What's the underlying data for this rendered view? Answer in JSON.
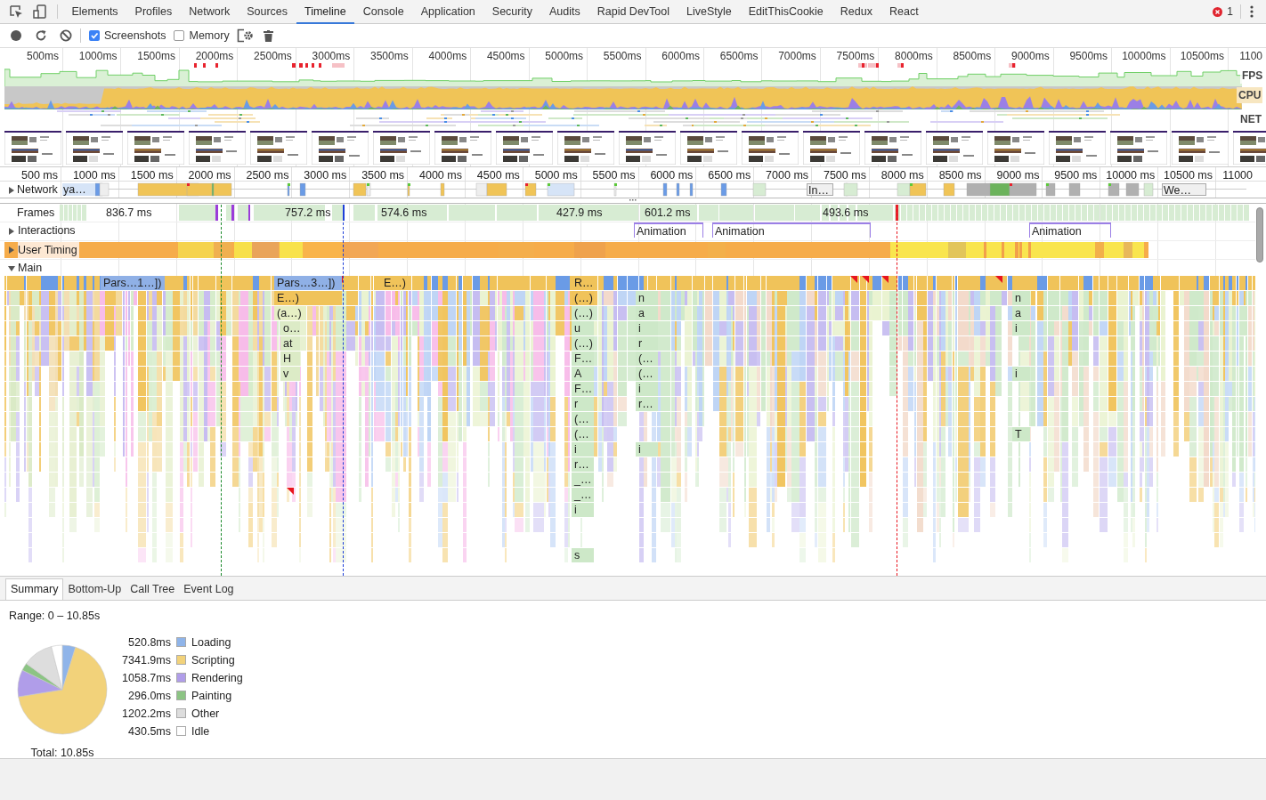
{
  "top_bar": {
    "tabs": [
      {
        "label": "Elements",
        "selected": false
      },
      {
        "label": "Profiles",
        "selected": false
      },
      {
        "label": "Network",
        "selected": false
      },
      {
        "label": "Sources",
        "selected": false
      },
      {
        "label": "Timeline",
        "selected": true
      },
      {
        "label": "Console",
        "selected": false
      },
      {
        "label": "Application",
        "selected": false
      },
      {
        "label": "Security",
        "selected": false
      },
      {
        "label": "Audits",
        "selected": false
      },
      {
        "label": "Rapid DevTool",
        "selected": false
      },
      {
        "label": "LiveStyle",
        "selected": false
      },
      {
        "label": "EditThisCookie",
        "selected": false
      },
      {
        "label": "Redux",
        "selected": false
      },
      {
        "label": "React",
        "selected": false
      }
    ],
    "error_count": "1"
  },
  "toolbar": {
    "options": [
      {
        "label": "Screenshots",
        "checked": true
      },
      {
        "label": "Memory",
        "checked": false
      }
    ]
  },
  "overview": {
    "ticks": [
      "500ms",
      "1000ms",
      "1500ms",
      "2000ms",
      "2500ms",
      "3000ms",
      "3500ms",
      "4000ms",
      "4500ms",
      "5000ms",
      "5500ms",
      "6000ms",
      "6500ms",
      "7000ms",
      "7500ms",
      "8000ms",
      "8500ms",
      "9000ms",
      "9500ms",
      "10000ms",
      "10500ms",
      "1100"
    ],
    "lanes": [
      "FPS",
      "CPU",
      "NET"
    ]
  },
  "ruler": {
    "ticks": [
      "500 ms",
      "1000 ms",
      "1500 ms",
      "2000 ms",
      "2500 ms",
      "3000 ms",
      "3500 ms",
      "4000 ms",
      "4500 ms",
      "5000 ms",
      "5500 ms",
      "6000 ms",
      "6500 ms",
      "7000 ms",
      "7500 ms",
      "8000 ms",
      "8500 ms",
      "9000 ms",
      "9500 ms",
      "10000 ms",
      "10500 ms",
      "11000"
    ]
  },
  "network": {
    "label": "Network",
    "expanded": false,
    "requests": [
      {
        "text": "ya…"
      },
      {
        "text": "In…"
      },
      {
        "text": "We…"
      }
    ]
  },
  "frames": {
    "label": "Frames",
    "durations": [
      "836.7 ms",
      "757.2 ms",
      "574.6 ms",
      "427.9 ms",
      "601.2 ms",
      "493.6 ms"
    ]
  },
  "interactions": {
    "label": "Interactions",
    "expanded": false,
    "entries": [
      "Animation",
      "Animation",
      "Animation"
    ]
  },
  "user_timing": {
    "label": "User Timing",
    "expanded": false
  },
  "main": {
    "label": "Main",
    "expanded": true,
    "columns": [
      {
        "entries": [
          "Pars…1…])"
        ]
      },
      {
        "entries": [
          "Pars…3…])",
          "E…)",
          "(a…)",
          "o…",
          "at",
          "H",
          "v"
        ]
      },
      {
        "entries": [
          "E…)"
        ]
      },
      {
        "entries": [
          "R…",
          "(…)",
          "(…)",
          "u",
          "(…)",
          "F…",
          "A",
          "F…",
          "r",
          "(…",
          "(…",
          "i",
          "r…",
          "_…",
          "_…",
          "i",
          "s"
        ]
      },
      {
        "entries": [
          "n",
          "a",
          "i",
          "r",
          "(…",
          "(…",
          "i",
          "r…",
          "i"
        ]
      },
      {
        "entries": [
          "n",
          "a",
          "i",
          "i",
          "T"
        ]
      }
    ]
  },
  "details": {
    "tabs": [
      {
        "label": "Summary",
        "selected": true
      },
      {
        "label": "Bottom-Up",
        "selected": false
      },
      {
        "label": "Call Tree",
        "selected": false
      },
      {
        "label": "Event Log",
        "selected": false
      }
    ],
    "range": "Range: 0 – 10.85s",
    "legend": [
      {
        "value": "520.8ms",
        "color": "#8fb4e9"
      },
      {
        "value": "7341.9ms",
        "color": "#f2d27a"
      },
      {
        "value": "1058.7ms",
        "color": "#b09de9"
      },
      {
        "value": "296.0ms",
        "color": "#8cc484"
      },
      {
        "value": "1202.2ms",
        "color": "#dddddd"
      },
      {
        "value": "430.5ms",
        "color": "#ffffff"
      }
    ],
    "chart_data": {
      "type": "pie",
      "categories": [
        "Loading",
        "Scripting",
        "Rendering",
        "Painting",
        "Other",
        "Idle"
      ],
      "values": [
        4.8,
        67.66,
        9.76,
        2.73,
        11.08,
        3.97
      ]
    },
    "total": "Total: 10.85s"
  }
}
